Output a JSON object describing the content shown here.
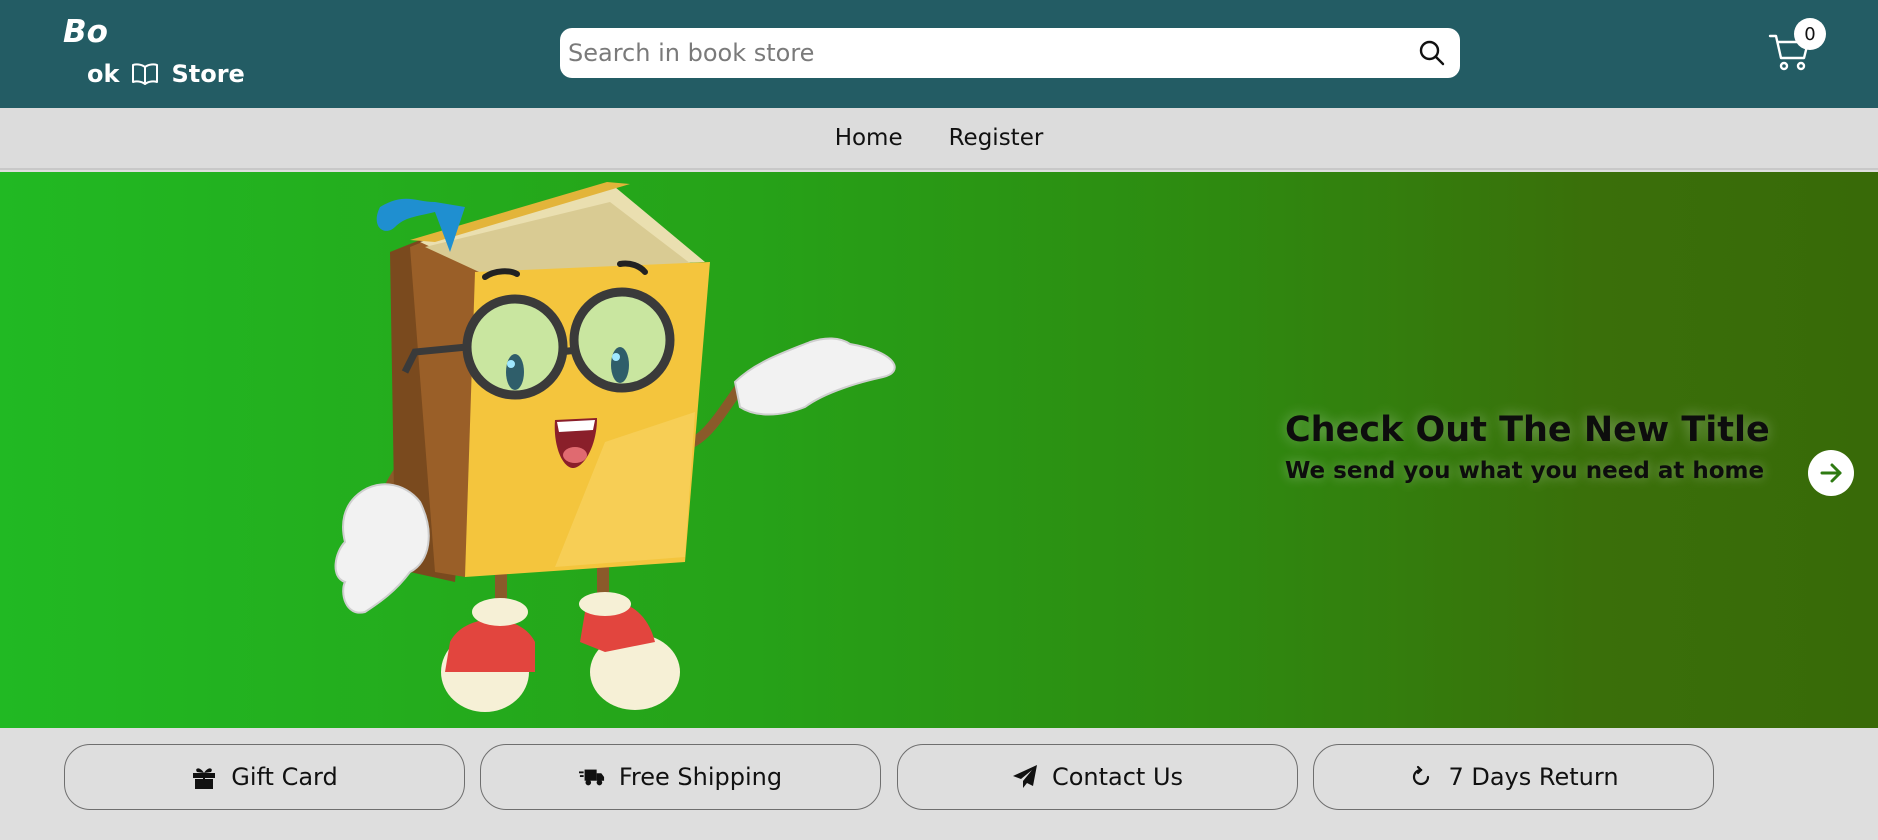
{
  "header": {
    "logo_top": "Bo",
    "logo_part": "ok",
    "logo_store": "Store",
    "search_placeholder": "Search in book store",
    "cart_count": "0",
    "background_color": "#235c64"
  },
  "nav": {
    "items": [
      {
        "label": "Home"
      },
      {
        "label": "Register"
      }
    ]
  },
  "hero": {
    "title": "Check Out The New Title",
    "subtitle": "We send you what you need at home",
    "gradient_start": "#21b923",
    "gradient_end": "#386a08"
  },
  "features": [
    {
      "label": "Gift Card",
      "icon": "gift-icon"
    },
    {
      "label": "Free Shipping",
      "icon": "truck-icon"
    },
    {
      "label": "Contact Us",
      "icon": "paper-plane-icon"
    },
    {
      "label": "7 Days Return",
      "icon": "rotate-icon"
    }
  ]
}
